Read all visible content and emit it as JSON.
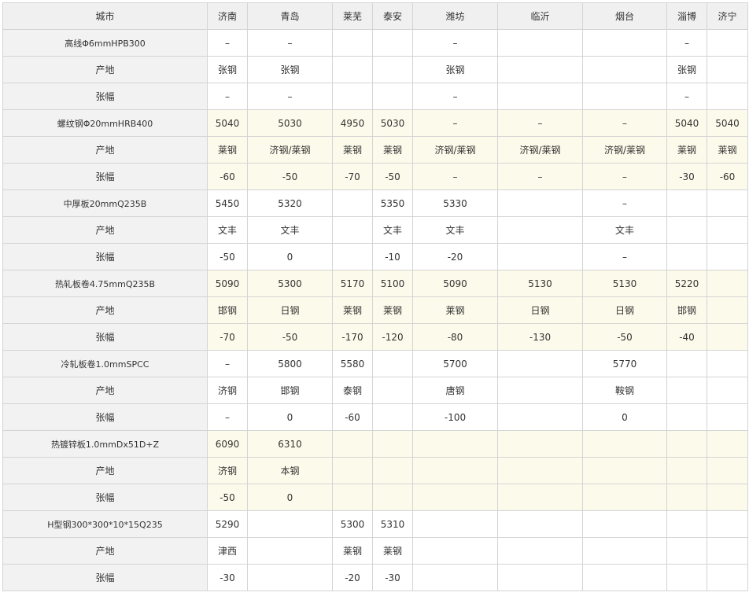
{
  "table": {
    "headers": [
      "城市",
      "济南",
      "青岛",
      "莱芜",
      "泰安",
      "潍坊",
      "临沂",
      "烟台",
      "淄博",
      "济宁"
    ],
    "rows": [
      {
        "label": "高线Φ6mmHPB300",
        "kind": "product",
        "alt": false,
        "cells": [
          "–",
          "–",
          "",
          "",
          "–",
          "",
          "",
          "–",
          ""
        ]
      },
      {
        "label": "产地",
        "kind": "origin",
        "alt": false,
        "cells": [
          "张钢",
          "张钢",
          "",
          "",
          "张钢",
          "",
          "",
          "张钢",
          ""
        ]
      },
      {
        "label": "张幅",
        "kind": "change",
        "alt": false,
        "cells": [
          "–",
          "–",
          "",
          "",
          "–",
          "",
          "",
          "–",
          ""
        ]
      },
      {
        "label": "螺纹钢Φ20mmHRB400",
        "kind": "product",
        "alt": true,
        "cells": [
          "5040",
          "5030",
          "4950",
          "5030",
          "–",
          "–",
          "–",
          "5040",
          "5040"
        ]
      },
      {
        "label": "产地",
        "kind": "origin",
        "alt": true,
        "cells": [
          "莱钢",
          "济钢/莱钢",
          "莱钢",
          "莱钢",
          "济钢/莱钢",
          "济钢/莱钢",
          "济钢/莱钢",
          "莱钢",
          "莱钢"
        ]
      },
      {
        "label": "张幅",
        "kind": "change",
        "alt": true,
        "cells": [
          "-60",
          "-50",
          "-70",
          "-50",
          "–",
          "–",
          "–",
          "-30",
          "-60"
        ]
      },
      {
        "label": "中厚板20mmQ235B",
        "kind": "product",
        "alt": false,
        "cells": [
          "5450",
          "5320",
          "",
          "5350",
          "5330",
          "",
          "–",
          "",
          ""
        ]
      },
      {
        "label": "产地",
        "kind": "origin",
        "alt": false,
        "cells": [
          "文丰",
          "文丰",
          "",
          "文丰",
          "文丰",
          "",
          "文丰",
          "",
          ""
        ]
      },
      {
        "label": "张幅",
        "kind": "change",
        "alt": false,
        "cells": [
          "-50",
          "0",
          "",
          "-10",
          "-20",
          "",
          "–",
          "",
          ""
        ]
      },
      {
        "label": "热轧板卷4.75mmQ235B",
        "kind": "product",
        "alt": true,
        "cells": [
          "5090",
          "5300",
          "5170",
          "5100",
          "5090",
          "5130",
          "5130",
          "5220",
          ""
        ]
      },
      {
        "label": "产地",
        "kind": "origin",
        "alt": true,
        "cells": [
          "邯钢",
          "日钢",
          "莱钢",
          "莱钢",
          "莱钢",
          "日钢",
          "日钢",
          "邯钢",
          ""
        ]
      },
      {
        "label": "张幅",
        "kind": "change",
        "alt": true,
        "cells": [
          "-70",
          "-50",
          "-170",
          "-120",
          "-80",
          "-130",
          "-50",
          "-40",
          ""
        ]
      },
      {
        "label": "冷轧板卷1.0mmSPCC",
        "kind": "product",
        "alt": false,
        "cells": [
          "–",
          "5800",
          "5580",
          "",
          "5700",
          "",
          "5770",
          "",
          ""
        ]
      },
      {
        "label": "产地",
        "kind": "origin",
        "alt": false,
        "cells": [
          "济钢",
          "邯钢",
          "泰钢",
          "",
          "唐钢",
          "",
          "鞍钢",
          "",
          ""
        ]
      },
      {
        "label": "张幅",
        "kind": "change",
        "alt": false,
        "cells": [
          "–",
          "0",
          "-60",
          "",
          "-100",
          "",
          "0",
          "",
          ""
        ]
      },
      {
        "label": "热镀锌板1.0mmDx51D+Z",
        "kind": "product",
        "alt": true,
        "cells": [
          "6090",
          "6310",
          "",
          "",
          "",
          "",
          "",
          "",
          ""
        ]
      },
      {
        "label": "产地",
        "kind": "origin",
        "alt": true,
        "cells": [
          "济钢",
          "本钢",
          "",
          "",
          "",
          "",
          "",
          "",
          ""
        ]
      },
      {
        "label": "张幅",
        "kind": "change",
        "alt": true,
        "cells": [
          "-50",
          "0",
          "",
          "",
          "",
          "",
          "",
          "",
          ""
        ]
      },
      {
        "label": "H型钢300*300*10*15Q235",
        "kind": "product",
        "alt": false,
        "cells": [
          "5290",
          "",
          "5300",
          "5310",
          "",
          "",
          "",
          "",
          ""
        ]
      },
      {
        "label": "产地",
        "kind": "origin",
        "alt": false,
        "cells": [
          "津西",
          "",
          "莱钢",
          "莱钢",
          "",
          "",
          "",
          "",
          ""
        ]
      },
      {
        "label": "张幅",
        "kind": "change",
        "alt": false,
        "cells": [
          "-30",
          "",
          "-20",
          "-30",
          "",
          "",
          "",
          "",
          ""
        ]
      }
    ]
  }
}
